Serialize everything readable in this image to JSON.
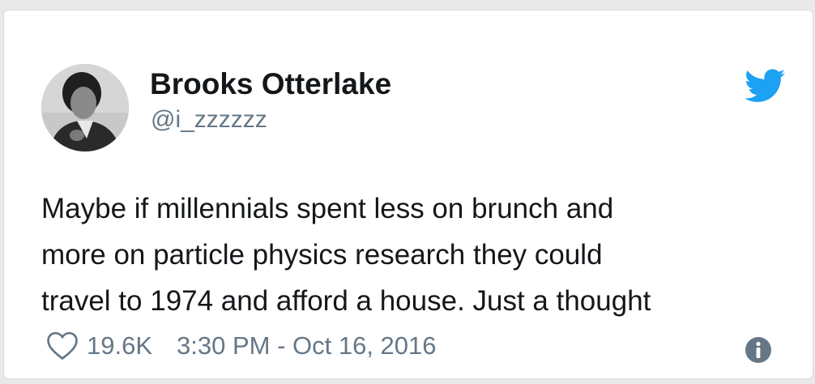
{
  "tweet": {
    "display_name": "Brooks Otterlake",
    "handle": "@i_zzzzzz",
    "text_lines": [
      "Maybe if millennials spent less on brunch and",
      "more on particle physics research they could",
      "travel to 1974 and afford a house. Just a thought"
    ],
    "likes": "19.6K",
    "timestamp": "3:30 PM - Oct 16, 2016"
  },
  "colors": {
    "twitter_blue": "#1da1f2",
    "secondary_text": "#657786",
    "primary_text": "#14171a"
  },
  "icons": {
    "brand": "twitter-bird-icon",
    "like": "heart-icon",
    "info": "info-icon",
    "avatar": "user-avatar"
  }
}
